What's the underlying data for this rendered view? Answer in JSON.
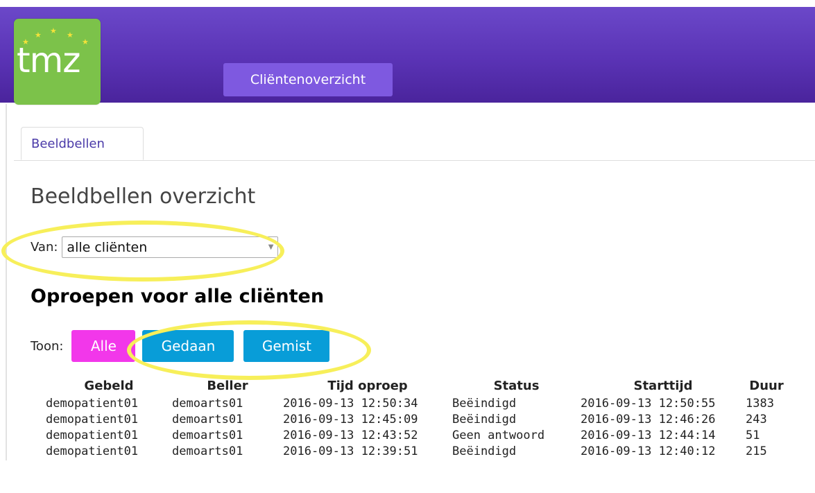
{
  "header": {
    "logo_text": "tmz",
    "nav_button_label": "Cliëntenoverzicht"
  },
  "tabs": [
    {
      "label": "Beeldbellen"
    }
  ],
  "page": {
    "title": "Beeldbellen overzicht",
    "van_label": "Van:",
    "van_selected": "alle cliënten",
    "section_title": "Oproepen voor alle cliënten",
    "toon_label": "Toon:",
    "filters": {
      "alle": "Alle",
      "gedaan": "Gedaan",
      "gemist": "Gemist"
    }
  },
  "colors": {
    "header": "#5a33b5",
    "logo_bg": "#7cc24a",
    "nav_button": "#7e59e0",
    "filter_alle": "#f237ea",
    "filter_blue": "#089dd8",
    "highlight": "#f7ef5a"
  },
  "table": {
    "headers": [
      "Gebeld",
      "Beller",
      "Tijd oproep",
      "Status",
      "Starttijd",
      "Duur"
    ],
    "rows": [
      [
        "demopatient01",
        "demoarts01",
        "2016-09-13 12:50:34",
        "Beëindigd",
        "2016-09-13 12:50:55",
        "1383"
      ],
      [
        "demopatient01",
        "demoarts01",
        "2016-09-13 12:45:09",
        "Beëindigd",
        "2016-09-13 12:46:26",
        "243"
      ],
      [
        "demopatient01",
        "demoarts01",
        "2016-09-13 12:43:52",
        "Geen antwoord",
        "2016-09-13 12:44:14",
        "51"
      ],
      [
        "demopatient01",
        "demoarts01",
        "2016-09-13 12:39:51",
        "Beëindigd",
        "2016-09-13 12:40:12",
        "215"
      ]
    ]
  }
}
